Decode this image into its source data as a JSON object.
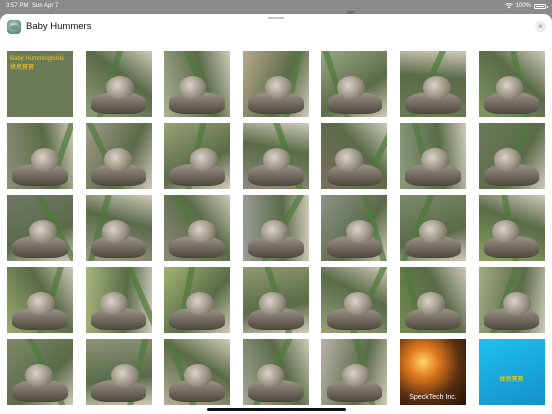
{
  "status_bar": {
    "time": "3:57 PM",
    "date": "Sun Apr 7",
    "battery": "100%"
  },
  "sheet": {
    "title": "Baby Hummers",
    "close_label": "×"
  },
  "thumbnails": [
    {
      "kind": "card",
      "name": "thumb-title-card",
      "lines": [
        "Baby Hummingbirds",
        "蜂鳥寶寶"
      ],
      "bg": "#6b7a57",
      "text_color": "#f2c51f"
    },
    {
      "kind": "photo",
      "bg": "#8f9d7b"
    },
    {
      "kind": "photo",
      "bg": "#a9b295"
    },
    {
      "kind": "photo",
      "bg": "#b7a98b"
    },
    {
      "kind": "photo",
      "bg": "#9aa883"
    },
    {
      "kind": "photo",
      "bg": "#6a7b55"
    },
    {
      "kind": "photo",
      "bg": "#7f9764"
    },
    {
      "kind": "photo",
      "bg": "#8e8f76"
    },
    {
      "kind": "photo",
      "bg": "#a39b8a"
    },
    {
      "kind": "photo",
      "bg": "#9aa277"
    },
    {
      "kind": "photo",
      "bg": "#8f8b7d"
    },
    {
      "kind": "photo",
      "bg": "#7b6f5e"
    },
    {
      "kind": "photo",
      "bg": "#8b9b7c"
    },
    {
      "kind": "photo",
      "bg": "#6c7a58"
    },
    {
      "kind": "photo",
      "bg": "#6f7966"
    },
    {
      "kind": "photo",
      "bg": "#a09a8b"
    },
    {
      "kind": "photo",
      "bg": "#8c8a7a"
    },
    {
      "kind": "photo",
      "bg": "#9b9d98"
    },
    {
      "kind": "photo",
      "bg": "#8e948a"
    },
    {
      "kind": "photo",
      "bg": "#7d8a6a"
    },
    {
      "kind": "photo",
      "bg": "#8aa45e"
    },
    {
      "kind": "photo",
      "bg": "#9bab6e"
    },
    {
      "kind": "photo",
      "bg": "#a7b67d"
    },
    {
      "kind": "photo",
      "bg": "#a2b472"
    },
    {
      "kind": "photo",
      "bg": "#8f9a70"
    },
    {
      "kind": "photo",
      "bg": "#97a27b"
    },
    {
      "kind": "photo",
      "bg": "#6f8c4c"
    },
    {
      "kind": "photo",
      "bg": "#a2ad81"
    },
    {
      "kind": "photo",
      "bg": "#7d8a6a"
    },
    {
      "kind": "photo",
      "bg": "#8c9478"
    },
    {
      "kind": "photo",
      "bg": "#b7ae9a"
    },
    {
      "kind": "photo",
      "bg": "#a4a796"
    },
    {
      "kind": "photo",
      "bg": "#b9b4a9"
    },
    {
      "kind": "card",
      "name": "thumb-specktech-card",
      "lines": [
        "SpeckTech Inc."
      ],
      "bg": "#3a2410",
      "text_color": "#ffffff"
    },
    {
      "kind": "card",
      "name": "thumb-app-card",
      "lines": [
        "蜂鳥寶寶"
      ],
      "bg": "#1aa7d8",
      "text_color": "#f0d71a"
    }
  ]
}
